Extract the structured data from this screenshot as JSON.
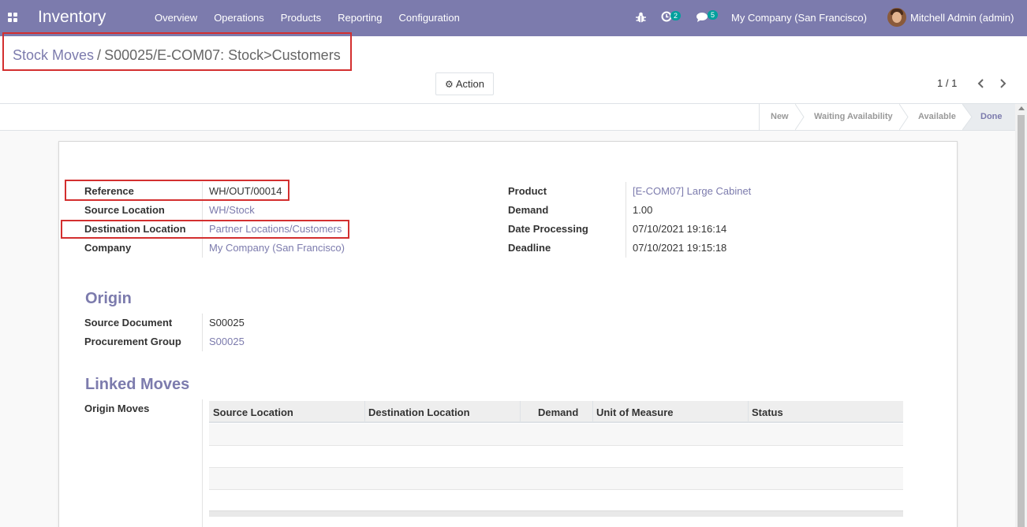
{
  "navbar": {
    "app_name": "Inventory",
    "menu": [
      "Overview",
      "Operations",
      "Products",
      "Reporting",
      "Configuration"
    ],
    "activity_count": "2",
    "messages_count": "5",
    "company": "My Company (San Francisco)",
    "user": "Mitchell Admin (admin)",
    "color": "#7c7bad"
  },
  "breadcrumb": {
    "parent": "Stock Moves",
    "separator": "/",
    "current": "S00025/E-COM07: Stock>Customers"
  },
  "toolbar": {
    "action_label": "Action",
    "pager": "1 / 1"
  },
  "statusbar": {
    "stages": [
      "New",
      "Waiting Availability",
      "Available",
      "Done"
    ],
    "active": "Done"
  },
  "form": {
    "left": [
      {
        "label": "Reference",
        "value": "WH/OUT/00014"
      },
      {
        "label": "Source Location",
        "value": "WH/Stock"
      },
      {
        "label": "Destination Location",
        "value": "Partner Locations/Customers"
      },
      {
        "label": "Company",
        "value": "My Company (San Francisco)"
      }
    ],
    "right": [
      {
        "label": "Product",
        "value": "[E-COM07] Large Cabinet"
      },
      {
        "label": "Demand",
        "value": "1.00"
      },
      {
        "label": "Date Processing",
        "value": "07/10/2021 19:16:14"
      },
      {
        "label": "Deadline",
        "value": "07/10/2021 19:15:18"
      }
    ]
  },
  "origin": {
    "title": "Origin",
    "fields": [
      {
        "label": "Source Document",
        "value": "S00025"
      },
      {
        "label": "Procurement Group",
        "value": "S00025"
      }
    ]
  },
  "linked_moves": {
    "title": "Linked Moves",
    "origin_moves_label": "Origin Moves",
    "columns": [
      "Source Location",
      "Destination Location",
      "Demand",
      "Unit of Measure",
      "Status"
    ]
  }
}
